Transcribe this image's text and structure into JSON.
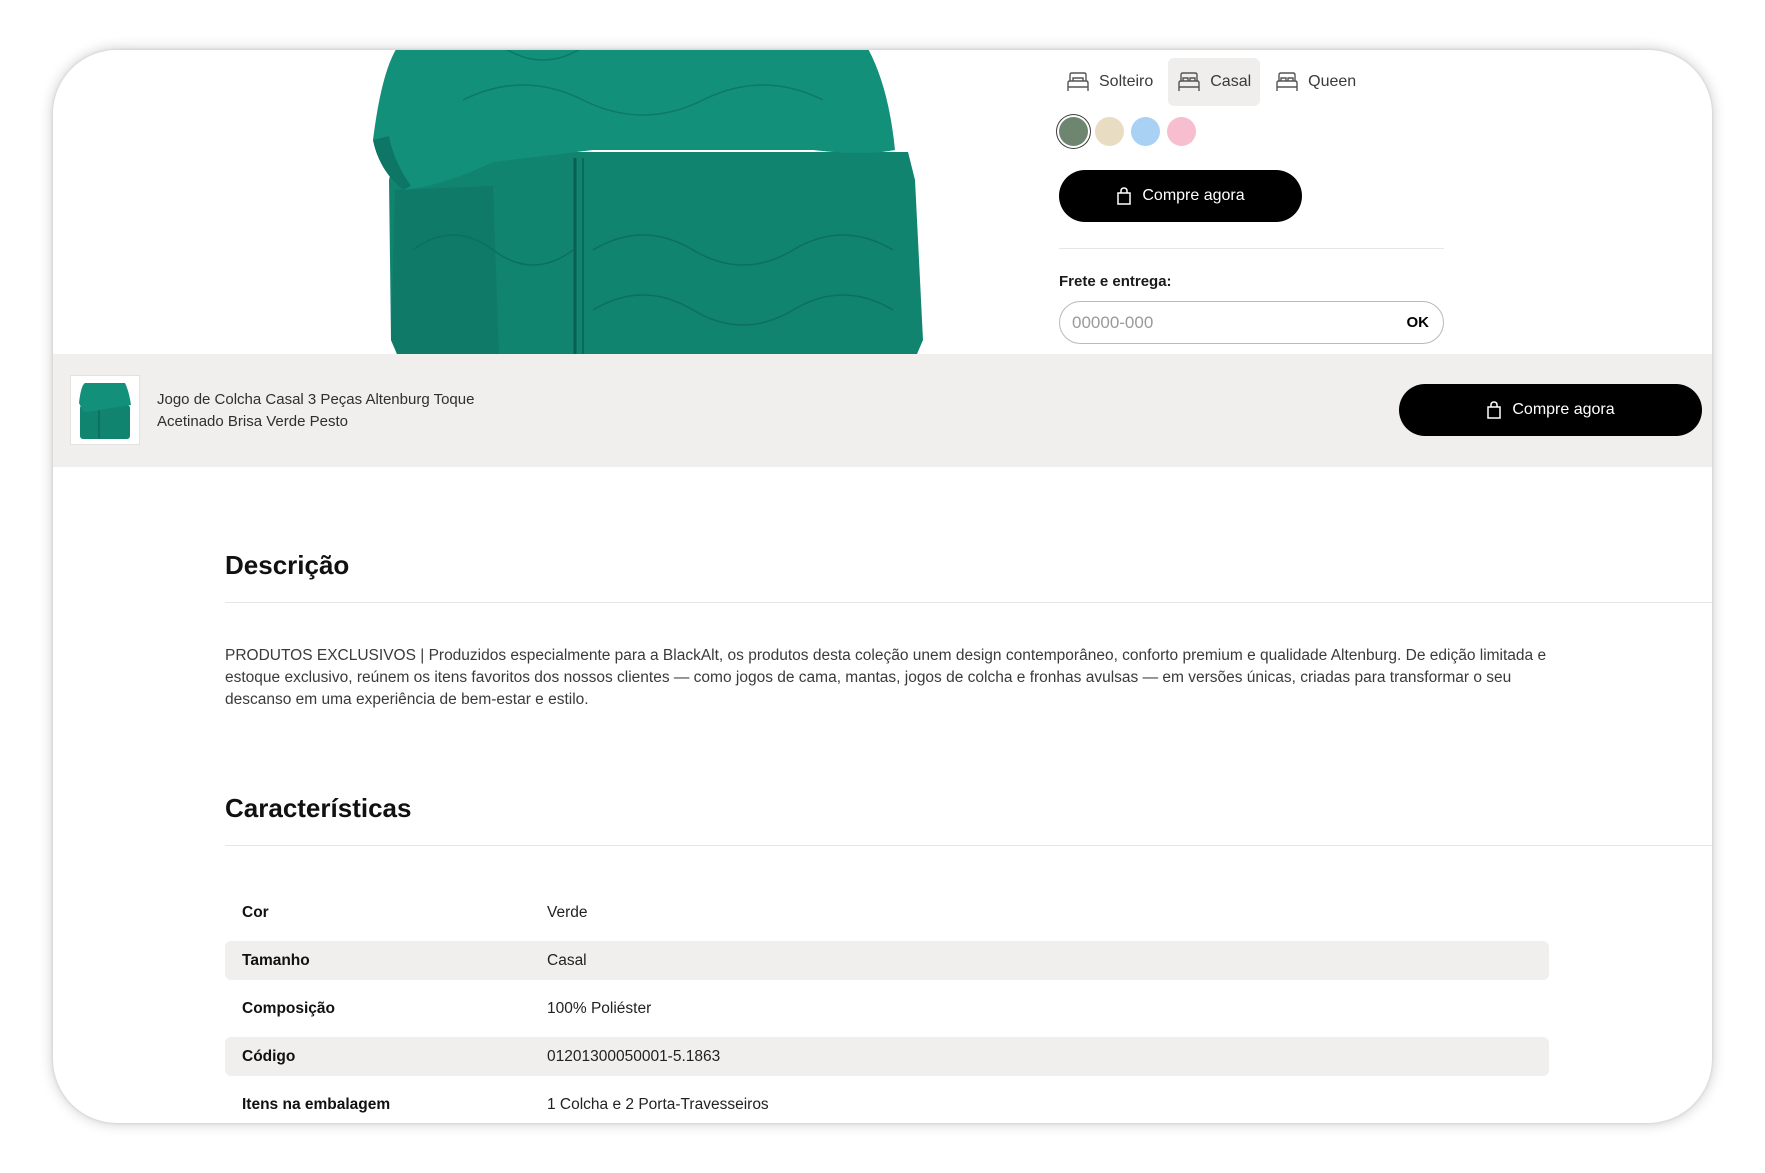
{
  "product": {
    "sizes": [
      {
        "label": "Solteiro",
        "selected": false
      },
      {
        "label": "Casal",
        "selected": true
      },
      {
        "label": "Queen",
        "selected": false
      }
    ],
    "colors": [
      {
        "hex": "#6e8570",
        "selected": true
      },
      {
        "hex": "#e8dcc3",
        "selected": false
      },
      {
        "hex": "#a9d1f3",
        "selected": false
      },
      {
        "hex": "#f7bed0",
        "selected": false
      }
    ],
    "buy_label": "Compre agora",
    "shipping": {
      "label": "Frete e entrega:",
      "placeholder": "00000-000",
      "ok_label": "OK"
    },
    "image_color": "#128570"
  },
  "sticky_bar": {
    "title": "Jogo de Colcha Casal 3 Peças Altenburg Toque Acetinado Brisa Verde Pesto",
    "buy_label": "Compre agora"
  },
  "description": {
    "title": "Descrição",
    "text": "PRODUTOS EXCLUSIVOS | Produzidos especialmente para a BlackAlt, os produtos desta coleção unem design contemporâneo, conforto premium e qualidade Altenburg. De edição limitada e estoque exclusivo, reúnem os itens favoritos dos nossos clientes — como jogos de cama, mantas, jogos de colcha e fronhas avulsas — em versões únicas, criadas para transformar o seu descanso em uma experiência de bem-estar e estilo."
  },
  "characteristics": {
    "title": "Características",
    "rows": [
      {
        "key": "Cor",
        "value": "Verde"
      },
      {
        "key": "Tamanho",
        "value": "Casal"
      },
      {
        "key": "Composição",
        "value": "100% Poliéster"
      },
      {
        "key": "Código",
        "value": "01201300050001-5.1863"
      },
      {
        "key": "Itens na embalagem",
        "value": "1 Colcha e 2 Porta-Travesseiros"
      }
    ]
  }
}
